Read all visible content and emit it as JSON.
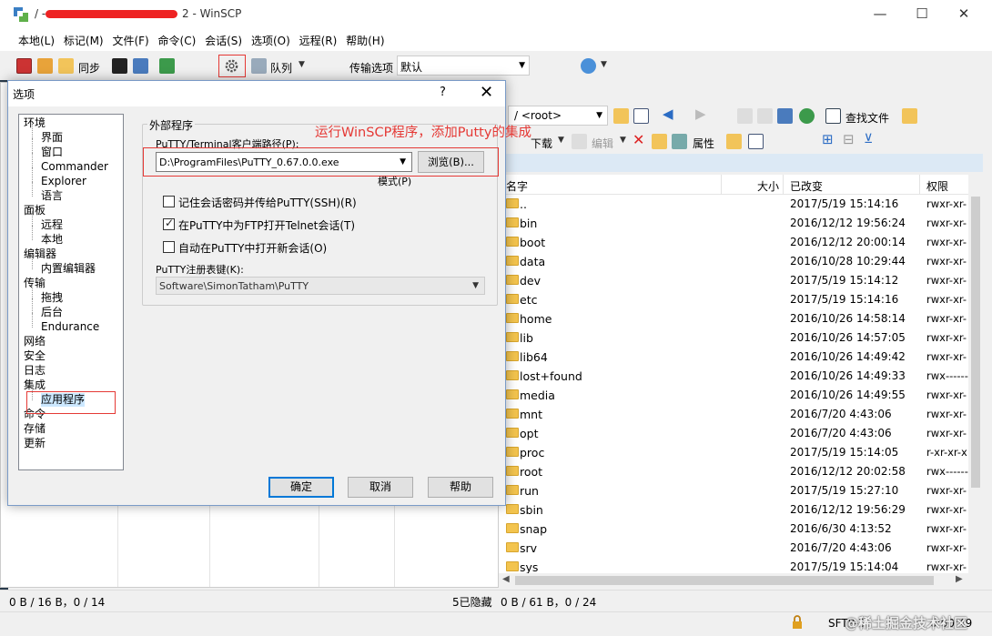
{
  "window": {
    "title_prefix": "/ -",
    "title_suffix": "2 - WinSCP",
    "controls": [
      "—",
      "☐",
      "✕"
    ]
  },
  "menu": [
    "本地(L)",
    "标记(M)",
    "文件(F)",
    "命令(C)",
    "会话(S)",
    "选项(O)",
    "远程(R)",
    "帮助(H)"
  ],
  "toolbar": {
    "sync_label": "同步",
    "queue_label": "队列",
    "transfer_label": "传输选项",
    "transfer_value": "默认"
  },
  "right_panel": {
    "path": "/ <root>",
    "find_files": "查找文件",
    "download": "下载",
    "edit": "编辑",
    "properties": "属性",
    "columns": {
      "name": "名字",
      "size": "大小",
      "changed": "已改变",
      "rights": "权限"
    },
    "files": [
      {
        "name": "..",
        "date": "2017/5/19 15:14:16",
        "perm": "rwxr-xr-"
      },
      {
        "name": "bin",
        "date": "2016/12/12 19:56:24",
        "perm": "rwxr-xr-"
      },
      {
        "name": "boot",
        "date": "2016/12/12 20:00:14",
        "perm": "rwxr-xr-"
      },
      {
        "name": "data",
        "date": "2016/10/28 10:29:44",
        "perm": "rwxr-xr-"
      },
      {
        "name": "dev",
        "date": "2017/5/19 15:14:12",
        "perm": "rwxr-xr-"
      },
      {
        "name": "etc",
        "date": "2017/5/19 15:14:16",
        "perm": "rwxr-xr-"
      },
      {
        "name": "home",
        "date": "2016/10/26 14:58:14",
        "perm": "rwxr-xr-"
      },
      {
        "name": "lib",
        "date": "2016/10/26 14:57:05",
        "perm": "rwxr-xr-"
      },
      {
        "name": "lib64",
        "date": "2016/10/26 14:49:42",
        "perm": "rwxr-xr-"
      },
      {
        "name": "lost+found",
        "date": "2016/10/26 14:49:33",
        "perm": "rwx------"
      },
      {
        "name": "media",
        "date": "2016/10/26 14:49:55",
        "perm": "rwxr-xr-"
      },
      {
        "name": "mnt",
        "date": "2016/7/20 4:43:06",
        "perm": "rwxr-xr-"
      },
      {
        "name": "opt",
        "date": "2016/7/20 4:43:06",
        "perm": "rwxr-xr-"
      },
      {
        "name": "proc",
        "date": "2017/5/19 15:14:05",
        "perm": "r-xr-xr-x"
      },
      {
        "name": "root",
        "date": "2016/12/12 20:02:58",
        "perm": "rwx------"
      },
      {
        "name": "run",
        "date": "2017/5/19 15:27:10",
        "perm": "rwxr-xr-"
      },
      {
        "name": "sbin",
        "date": "2016/12/12 19:56:29",
        "perm": "rwxr-xr-"
      },
      {
        "name": "snap",
        "date": "2016/6/30 4:13:52",
        "perm": "rwxr-xr-"
      },
      {
        "name": "srv",
        "date": "2016/7/20 4:43:06",
        "perm": "rwxr-xr-"
      },
      {
        "name": "sys",
        "date": "2017/5/19 15:14:04",
        "perm": "rwxr-xr-"
      }
    ]
  },
  "status": {
    "left": "0 B / 16 B，0 / 14",
    "hidden": "5已隐藏",
    "right": "0 B / 61 B，0 / 24",
    "protocol": "SFTP-3",
    "elapsed": "0:00:49"
  },
  "watermark": "@稀土掘金技术社区",
  "dialog": {
    "title": "选项",
    "help_glyph": "?",
    "close_glyph": "✕",
    "tree": [
      {
        "label": "环境",
        "level": 0
      },
      {
        "label": "界面",
        "level": 1
      },
      {
        "label": "窗口",
        "level": 1
      },
      {
        "label": "Commander",
        "level": 1
      },
      {
        "label": "Explorer",
        "level": 1
      },
      {
        "label": "语言",
        "level": 1
      },
      {
        "label": "面板",
        "level": 0
      },
      {
        "label": "远程",
        "level": 1
      },
      {
        "label": "本地",
        "level": 1
      },
      {
        "label": "编辑器",
        "level": 0
      },
      {
        "label": "内置编辑器",
        "level": 1
      },
      {
        "label": "传输",
        "level": 0
      },
      {
        "label": "拖拽",
        "level": 1
      },
      {
        "label": "后台",
        "level": 1
      },
      {
        "label": "Endurance",
        "level": 1
      },
      {
        "label": "网络",
        "level": 0
      },
      {
        "label": "安全",
        "level": 0
      },
      {
        "label": "日志",
        "level": 0
      },
      {
        "label": "集成",
        "level": 0
      },
      {
        "label": "应用程序",
        "level": 1,
        "selected": true
      },
      {
        "label": "命令",
        "level": 0
      },
      {
        "label": "存储",
        "level": 0
      },
      {
        "label": "更新",
        "level": 0
      }
    ],
    "group_title": "外部程序",
    "putty_path_label": "PuTTY/Terminal客户端路径(P):",
    "putty_path_value": "D:\\ProgramFiles\\PuTTY_0.67.0.0.exe",
    "browse_label": "浏览(B)...",
    "pattern_label": "模式(P)",
    "options": [
      {
        "label": "记住会话密码并传给PuTTY(SSH)(R)",
        "checked": false
      },
      {
        "label": "在PuTTY中为FTP打开Telnet会话(T)",
        "checked": true
      },
      {
        "label": "自动在PuTTY中打开新会话(O)",
        "checked": false
      }
    ],
    "registry_label": "PuTTY注册表键(K):",
    "registry_value": "Software\\SimonTatham\\PuTTY",
    "ok_label": "确定",
    "cancel_label": "取消",
    "help_label": "帮助"
  },
  "annotation": "运行WinSCP程序，添加Putty的集成"
}
